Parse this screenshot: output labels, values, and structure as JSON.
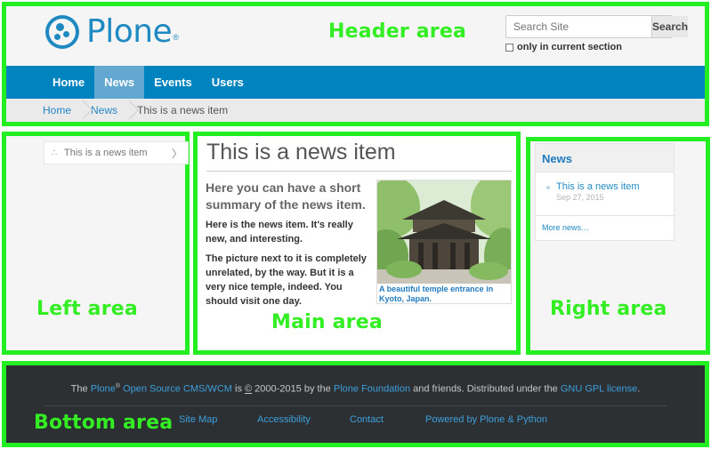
{
  "header": {
    "logo_text": "Plone",
    "logo_mark": "®",
    "search": {
      "placeholder": "Search Site",
      "button_label": "Search",
      "option_label": "only in current section",
      "option_checked": false
    },
    "nav": [
      {
        "label": "Home",
        "active": false
      },
      {
        "label": "News",
        "active": true
      },
      {
        "label": "Events",
        "active": false
      },
      {
        "label": "Users",
        "active": false
      }
    ],
    "breadcrumb": [
      "Home",
      "News",
      "This is a news item"
    ]
  },
  "left": {
    "nav_item": "This is a news item"
  },
  "main": {
    "title": "This is a news item",
    "summary": "Here you can have a short summary of the news item.",
    "paragraphs": [
      "Here is the news item. It's really new, and interesting.",
      "The picture next to it is completely unrelated, by the way. But it is a very nice temple, indeed. You should visit one day."
    ],
    "image_caption": "A beautiful temple entrance in Kyoto, Japan."
  },
  "right": {
    "portlet_title": "News",
    "items": [
      {
        "title": "This is a news item",
        "date": "Sep 27, 2015"
      }
    ],
    "more_link": "More news…"
  },
  "footer": {
    "line": {
      "prefix": "The ",
      "plone": "Plone",
      "reg": "®",
      "oss": "Open Source CMS/WCM",
      "is": " is ",
      "copyright": "©",
      "years": " 2000-2015 by the ",
      "foundation": "Plone Foundation",
      "friends": " and friends. Distributed under the ",
      "license": "GNU GPL license",
      "end": "."
    },
    "links": [
      "Site Map",
      "Accessibility",
      "Contact",
      "Powered by Plone & Python"
    ]
  },
  "regions": {
    "header": "Header area",
    "left": "Left area",
    "main": "Main area",
    "right": "Right area",
    "bottom": "Bottom area"
  },
  "colors": {
    "frame": "#22ee22",
    "brand": "#0083be",
    "footer_bg": "#2d3033"
  }
}
